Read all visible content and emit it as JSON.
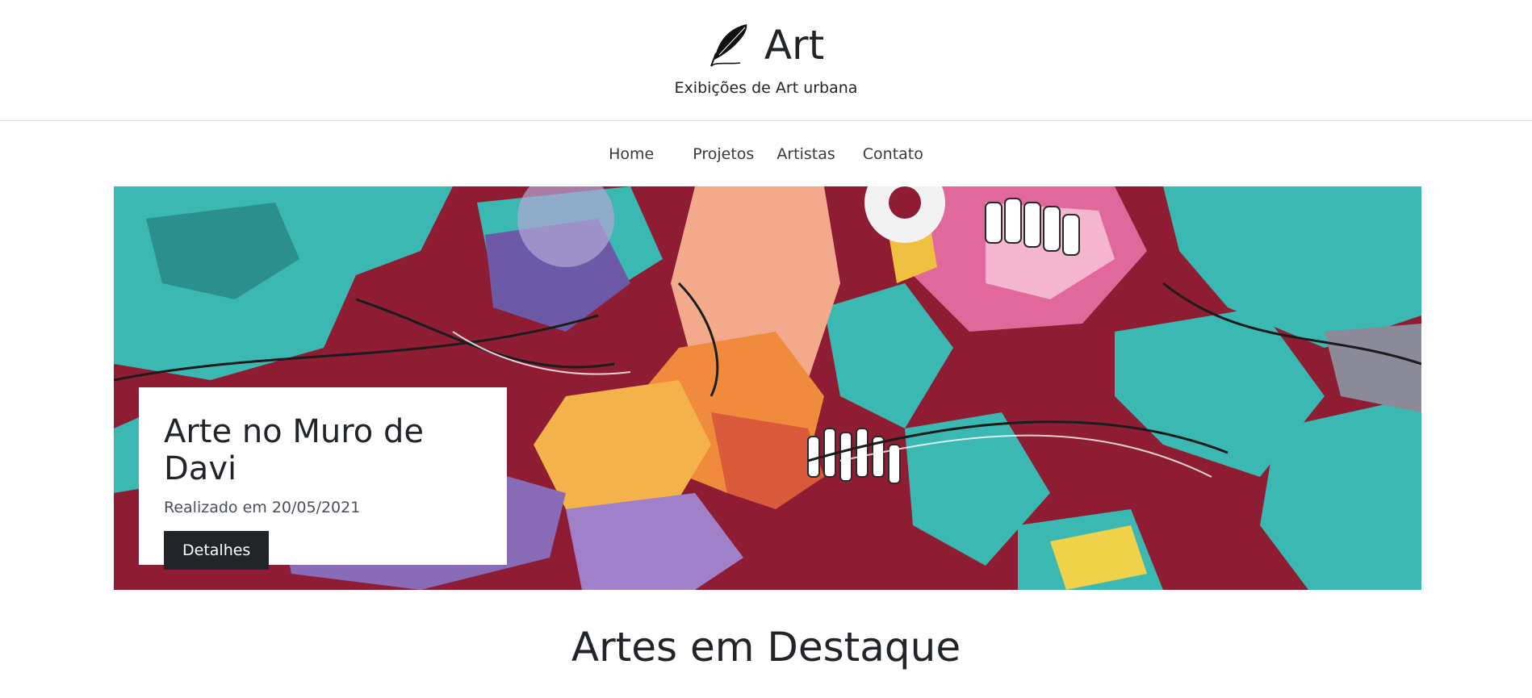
{
  "header": {
    "title": "Art",
    "subtitle": "Exibições de Art urbana",
    "logo_icon": "feather-icon"
  },
  "nav": {
    "items": [
      "Home",
      "Projetos",
      "Artistas",
      "Contato"
    ]
  },
  "hero": {
    "image": "graffiti-mural-image",
    "card": {
      "title": "Arte no Muro de Davi",
      "date": "Realizado em 20/05/2021",
      "button_label": "Detalhes"
    }
  },
  "section": {
    "title": "Artes em Destaque"
  },
  "colors": {
    "text": "#212529",
    "button_bg": "#212529",
    "mural_red": "#8e1d33",
    "mural_teal": "#3cb8b2",
    "mural_pink": "#e0689a",
    "mural_orange": "#f08a3c",
    "mural_purple": "#8a6bb8"
  }
}
